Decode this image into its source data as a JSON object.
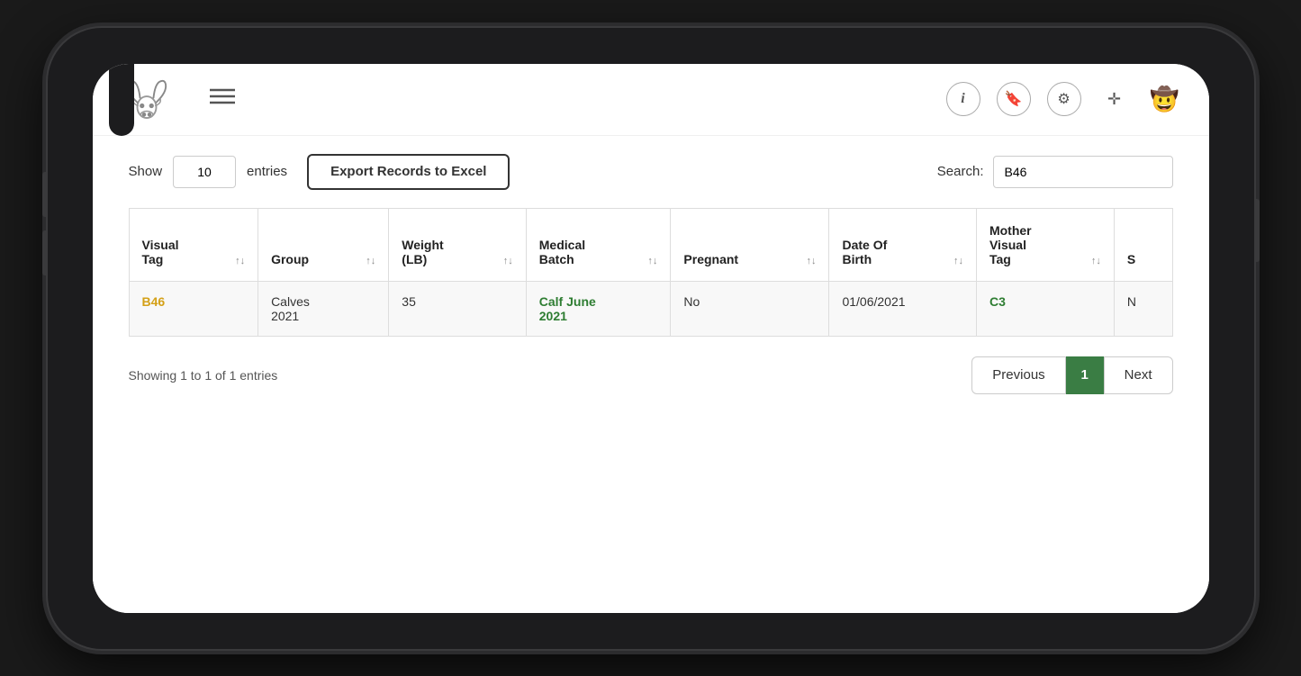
{
  "nav": {
    "hamburger_label": "≡",
    "icons": [
      {
        "name": "info-icon",
        "symbol": "ⓘ"
      },
      {
        "name": "bookmark-icon",
        "symbol": "🔖"
      },
      {
        "name": "settings-icon",
        "symbol": "⚙"
      },
      {
        "name": "move-icon",
        "symbol": "⤢"
      },
      {
        "name": "user-icon",
        "symbol": "🤠"
      }
    ]
  },
  "controls": {
    "show_label": "Show",
    "entries_value": "10",
    "entries_label": "entries",
    "export_btn_label": "Export Records to Excel",
    "search_label": "Search:",
    "search_value": "B46"
  },
  "table": {
    "columns": [
      {
        "key": "visual_tag",
        "label": "Visual\nTag"
      },
      {
        "key": "group",
        "label": "Group"
      },
      {
        "key": "weight",
        "label": "Weight\n(LB)"
      },
      {
        "key": "medical_batch",
        "label": "Medical\nBatch"
      },
      {
        "key": "pregnant",
        "label": "Pregnant"
      },
      {
        "key": "date_of_birth",
        "label": "Date Of\nBirth"
      },
      {
        "key": "mother_visual_tag",
        "label": "Mother\nVisual\nTag"
      },
      {
        "key": "s",
        "label": "S"
      }
    ],
    "rows": [
      {
        "visual_tag": "B46",
        "visual_tag_color": "yellow",
        "group": "Calves\n2021",
        "weight": "35",
        "medical_batch": "Calf June\n2021",
        "medical_batch_color": "green",
        "pregnant": "No",
        "date_of_birth": "01/06/2021",
        "mother_visual_tag": "C3",
        "mother_visual_tag_color": "green",
        "s": "N"
      }
    ]
  },
  "pagination": {
    "showing_text": "Showing 1 to 1 of 1 entries",
    "previous_label": "Previous",
    "current_page": "1",
    "next_label": "Next"
  }
}
